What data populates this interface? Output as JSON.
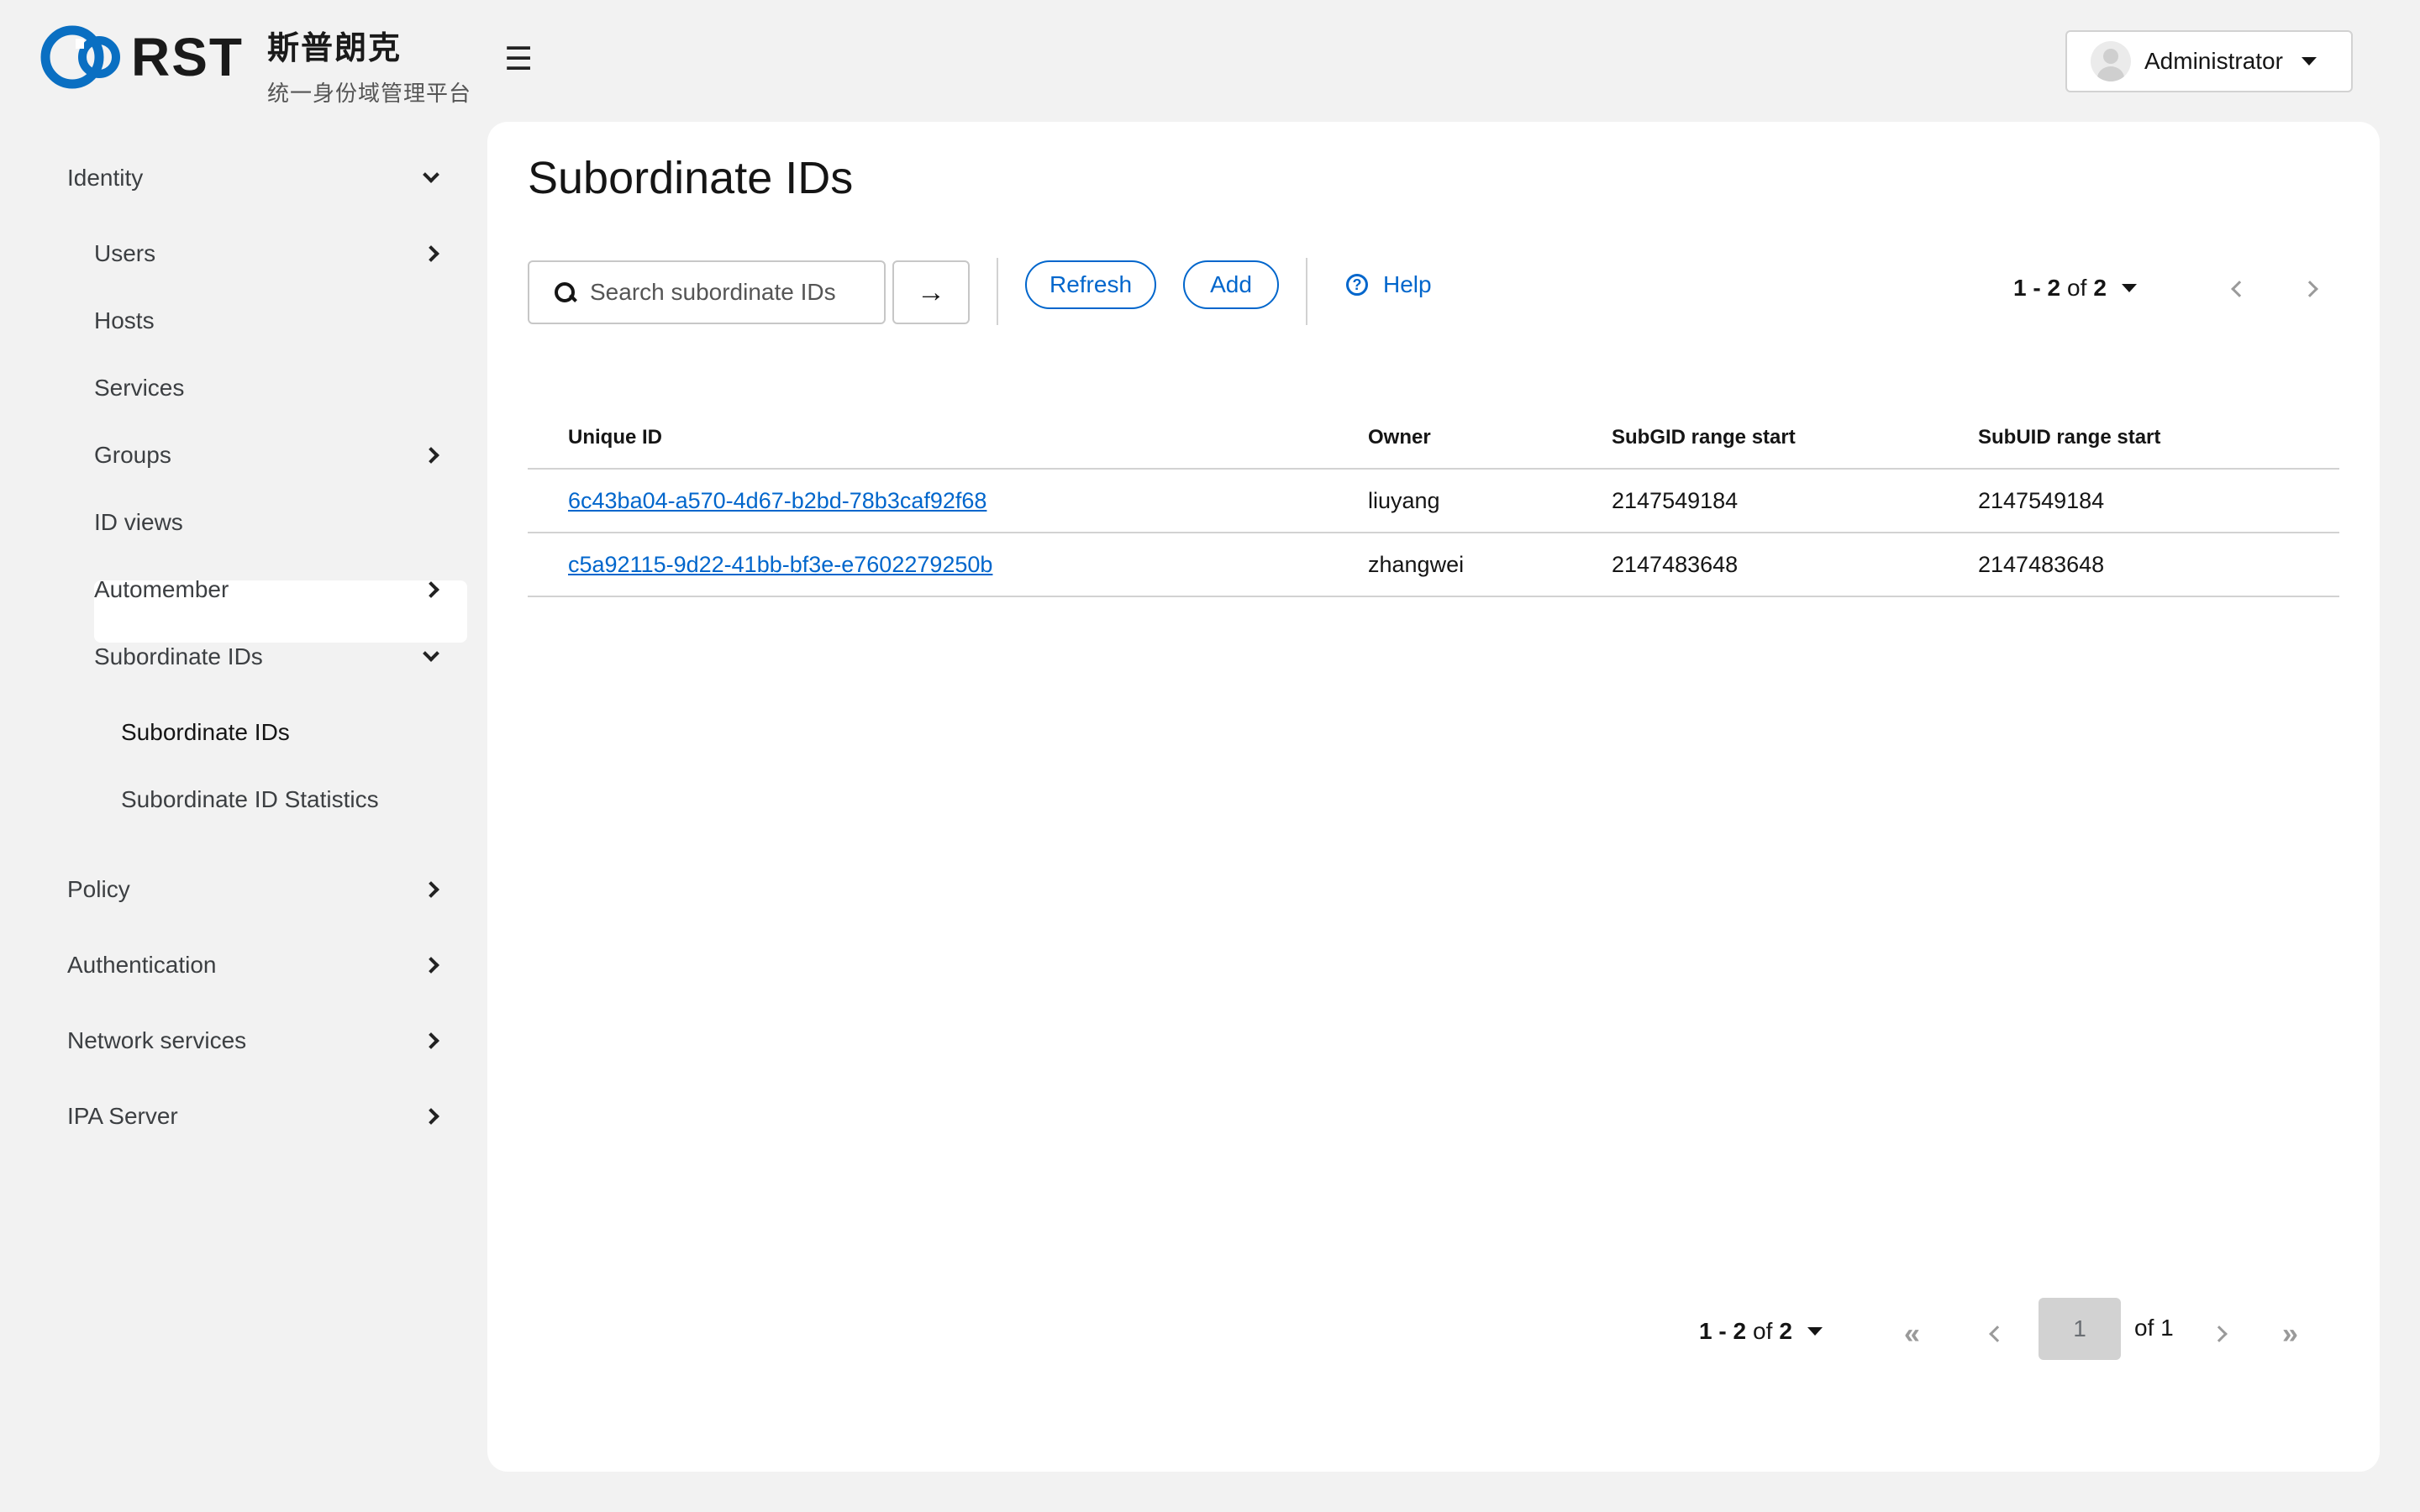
{
  "header": {
    "logo_text": "RST",
    "brand_title": "斯普朗克",
    "brand_subtitle": "统一身份域管理平台",
    "menu_icon": "hamburger-icon",
    "user_name": "Administrator"
  },
  "sidebar": {
    "identity": "Identity",
    "users": "Users",
    "hosts": "Hosts",
    "services": "Services",
    "groups": "Groups",
    "id_views": "ID views",
    "automember": "Automember",
    "subordinate_ids": "Subordinate IDs",
    "sub_subordinate_ids": "Subordinate IDs",
    "sub_statistics": "Subordinate ID Statistics",
    "policy": "Policy",
    "authentication": "Authentication",
    "network_services": "Network services",
    "ipa_server": "IPA Server"
  },
  "main": {
    "title": "Subordinate IDs",
    "search_placeholder": "Search subordinate IDs",
    "refresh": "Refresh",
    "add": "Add",
    "help": "Help",
    "pager": {
      "range": "1 - 2",
      "of": "of",
      "total": "2"
    },
    "table": {
      "headers": [
        "Unique ID",
        "Owner",
        "SubGID range start",
        "SubUID range start"
      ],
      "rows": [
        [
          "6c43ba04-a570-4d67-b2bd-78b3caf92f68",
          "liuyang",
          "2147549184",
          "2147549184"
        ],
        [
          "c5a92115-9d22-41bb-bf3e-e7602279250b",
          "zhangwei",
          "2147483648",
          "2147483648"
        ]
      ]
    },
    "bottom_pager": {
      "range": "1 - 2",
      "of": "of",
      "total": "2",
      "page": "1",
      "of_pages": "of 1"
    }
  }
}
